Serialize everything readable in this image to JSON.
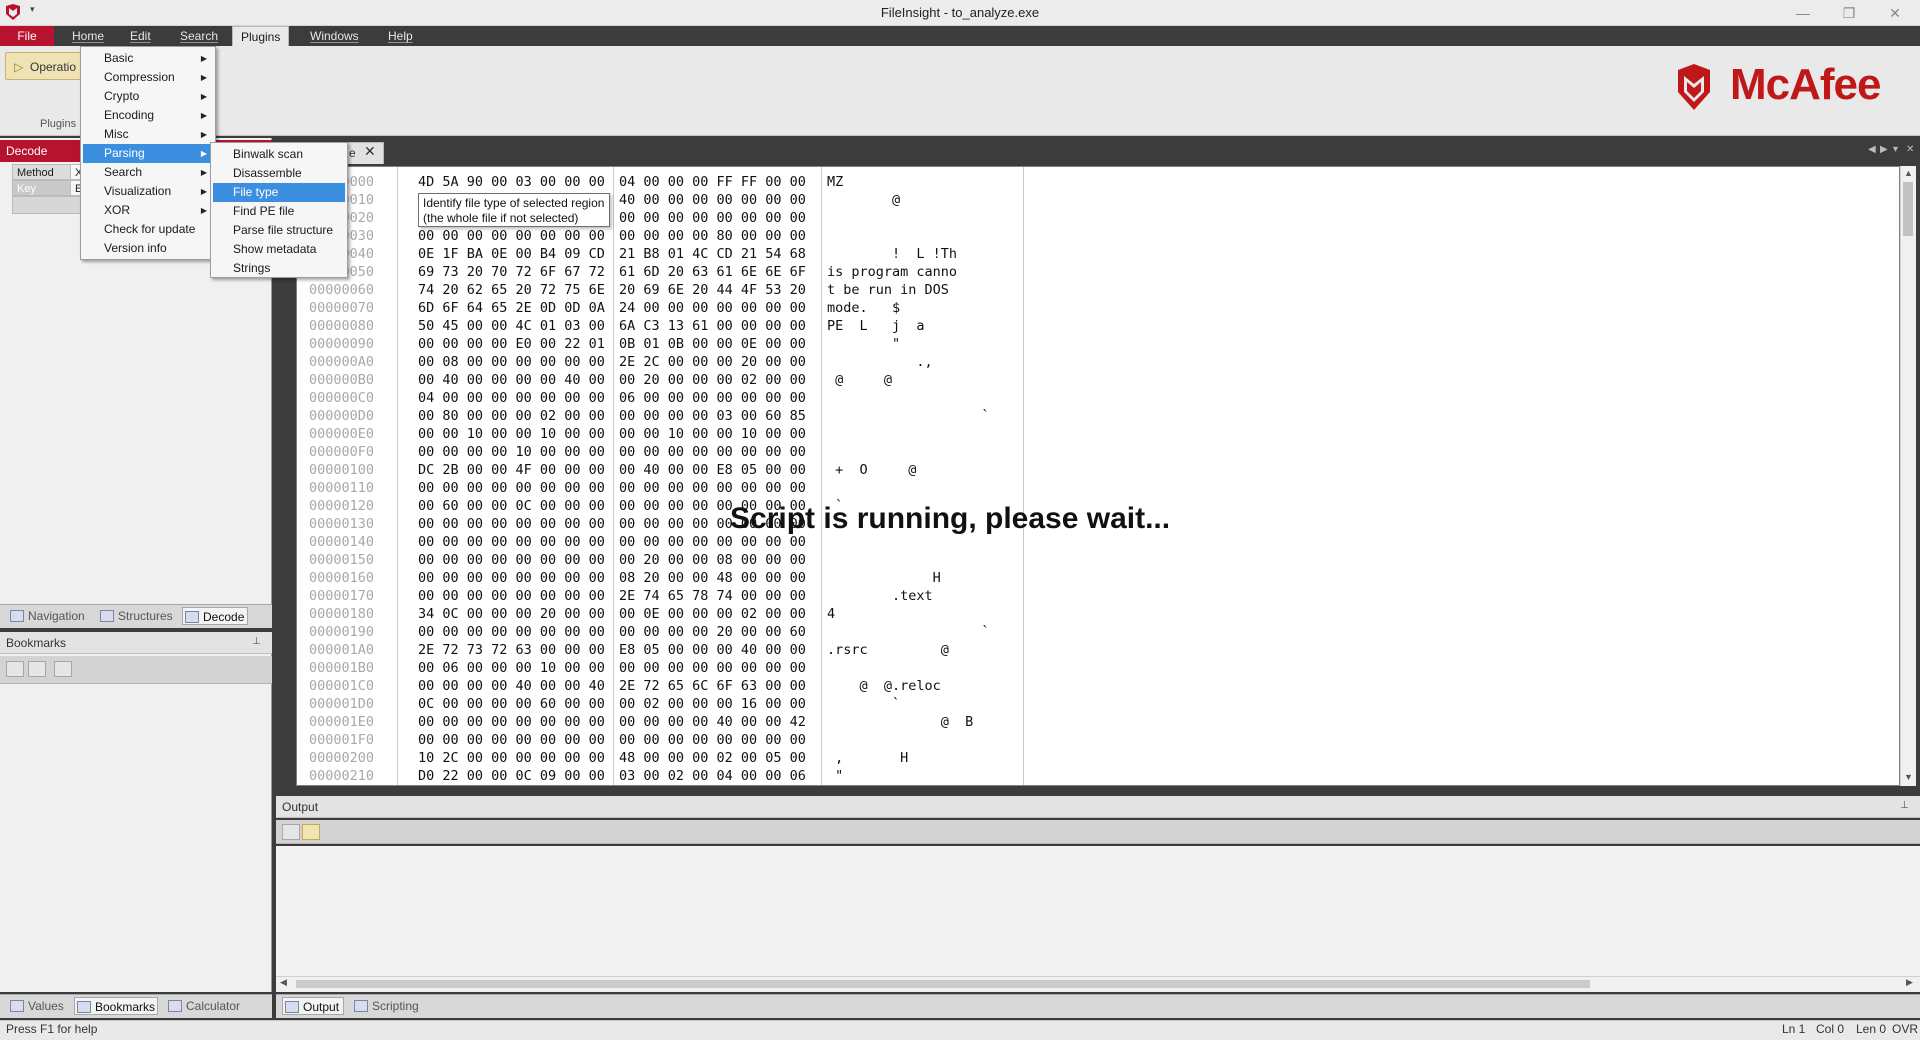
{
  "window": {
    "title": "FileInsight - to_analyze.exe",
    "controls": [
      "—",
      "❐",
      "✕"
    ]
  },
  "menubar": {
    "tabs": [
      "File",
      "Home",
      "Edit",
      "Search",
      "Plugins",
      "Windows",
      "Help"
    ]
  },
  "ribbon": {
    "operations_label": "Operatio",
    "group_label": "Plugins",
    "brand": "McAfee"
  },
  "plugins_menu": {
    "items": [
      {
        "label": "Basic",
        "submenu": true
      },
      {
        "label": "Compression",
        "submenu": true
      },
      {
        "label": "Crypto",
        "submenu": true
      },
      {
        "label": "Encoding",
        "submenu": true
      },
      {
        "label": "Misc",
        "submenu": true
      },
      {
        "label": "Parsing",
        "submenu": true
      },
      {
        "label": "Search",
        "submenu": true
      },
      {
        "label": "Visualization",
        "submenu": true
      },
      {
        "label": "XOR",
        "submenu": true
      },
      {
        "label": "Check for update",
        "submenu": false
      },
      {
        "label": "Version info",
        "submenu": false
      }
    ],
    "highlighted": "Parsing"
  },
  "parsing_submenu": {
    "items": [
      "Binwalk scan",
      "Disassemble",
      "File type",
      "Find PE file",
      "Parse file structure",
      "Show metadata",
      "Strings"
    ],
    "highlighted": "File type"
  },
  "tooltip": {
    "line1": "Identify file type of selected region",
    "line2": "(the whole file if not selected)"
  },
  "decode_panel": {
    "title": "Decode",
    "method_label": "Method",
    "method_value": "X",
    "key_label": "Key",
    "key_value": "E"
  },
  "left_tabs": [
    "Navigation",
    "Structures",
    "Decode"
  ],
  "bookmarks": {
    "title": "Bookmarks",
    "pin": "⊥"
  },
  "left_bottom_tabs": [
    "Values",
    "Bookmarks",
    "Calculator"
  ],
  "document": {
    "tab_label": "e",
    "close": "✕"
  },
  "hex_rows": [
    {
      "off": "00000000",
      "h1": "4D 5A 90 00 03 00 00 00",
      "h2": "04 00 00 00 FF FF 00 00",
      "asc": "MZ"
    },
    {
      "off": "00000010",
      "h1": "B8 00 00 00 00 00 00 00",
      "h2": "40 00 00 00 00 00 00 00",
      "asc": "        @"
    },
    {
      "off": "00000020",
      "h1": "00 00 00 00 00 00 00 00",
      "h2": "00 00 00 00 00 00 00 00",
      "asc": ""
    },
    {
      "off": "00000030",
      "h1": "00 00 00 00 00 00 00 00",
      "h2": "00 00 00 00 80 00 00 00",
      "asc": ""
    },
    {
      "off": "00000040",
      "h1": "0E 1F BA 0E 00 B4 09 CD",
      "h2": "21 B8 01 4C CD 21 54 68",
      "asc": "        !  L !Th"
    },
    {
      "off": "00000050",
      "h1": "69 73 20 70 72 6F 67 72",
      "h2": "61 6D 20 63 61 6E 6E 6F",
      "asc": "is program canno"
    },
    {
      "off": "00000060",
      "h1": "74 20 62 65 20 72 75 6E",
      "h2": "20 69 6E 20 44 4F 53 20",
      "asc": "t be run in DOS"
    },
    {
      "off": "00000070",
      "h1": "6D 6F 64 65 2E 0D 0D 0A",
      "h2": "24 00 00 00 00 00 00 00",
      "asc": "mode.   $"
    },
    {
      "off": "00000080",
      "h1": "50 45 00 00 4C 01 03 00",
      "h2": "6A C3 13 61 00 00 00 00",
      "asc": "PE  L   j  a"
    },
    {
      "off": "00000090",
      "h1": "00 00 00 00 E0 00 22 01",
      "h2": "0B 01 0B 00 00 0E 00 00",
      "asc": "        \""
    },
    {
      "off": "000000A0",
      "h1": "00 08 00 00 00 00 00 00",
      "h2": "2E 2C 00 00 00 20 00 00",
      "asc": "           .,"
    },
    {
      "off": "000000B0",
      "h1": "00 40 00 00 00 00 40 00",
      "h2": "00 20 00 00 00 02 00 00",
      "asc": " @     @"
    },
    {
      "off": "000000C0",
      "h1": "04 00 00 00 00 00 00 00",
      "h2": "06 00 00 00 00 00 00 00",
      "asc": ""
    },
    {
      "off": "000000D0",
      "h1": "00 80 00 00 00 02 00 00",
      "h2": "00 00 00 00 03 00 60 85",
      "asc": "                   `"
    },
    {
      "off": "000000E0",
      "h1": "00 00 10 00 00 10 00 00",
      "h2": "00 00 10 00 00 10 00 00",
      "asc": ""
    },
    {
      "off": "000000F0",
      "h1": "00 00 00 00 10 00 00 00",
      "h2": "00 00 00 00 00 00 00 00",
      "asc": ""
    },
    {
      "off": "00000100",
      "h1": "DC 2B 00 00 4F 00 00 00",
      "h2": "00 40 00 00 E8 05 00 00",
      "asc": " +  O     @"
    },
    {
      "off": "00000110",
      "h1": "00 00 00 00 00 00 00 00",
      "h2": "00 00 00 00 00 00 00 00",
      "asc": ""
    },
    {
      "off": "00000120",
      "h1": "00 60 00 00 0C 00 00 00",
      "h2": "00 00 00 00 00 00 00 00",
      "asc": " `"
    },
    {
      "off": "00000130",
      "h1": "00 00 00 00 00 00 00 00",
      "h2": "00 00 00 00 00 00 00 00",
      "asc": ""
    },
    {
      "off": "00000140",
      "h1": "00 00 00 00 00 00 00 00",
      "h2": "00 00 00 00 00 00 00 00",
      "asc": ""
    },
    {
      "off": "00000150",
      "h1": "00 00 00 00 00 00 00 00",
      "h2": "00 20 00 00 08 00 00 00",
      "asc": ""
    },
    {
      "off": "00000160",
      "h1": "00 00 00 00 00 00 00 00",
      "h2": "08 20 00 00 48 00 00 00",
      "asc": "             H"
    },
    {
      "off": "00000170",
      "h1": "00 00 00 00 00 00 00 00",
      "h2": "2E 74 65 78 74 00 00 00",
      "asc": "        .text"
    },
    {
      "off": "00000180",
      "h1": "34 0C 00 00 00 20 00 00",
      "h2": "00 0E 00 00 00 02 00 00",
      "asc": "4"
    },
    {
      "off": "00000190",
      "h1": "00 00 00 00 00 00 00 00",
      "h2": "00 00 00 00 20 00 00 60",
      "asc": "                   `"
    },
    {
      "off": "000001A0",
      "h1": "2E 72 73 72 63 00 00 00",
      "h2": "E8 05 00 00 00 40 00 00",
      "asc": ".rsrc         @"
    },
    {
      "off": "000001B0",
      "h1": "00 06 00 00 00 10 00 00",
      "h2": "00 00 00 00 00 00 00 00",
      "asc": ""
    },
    {
      "off": "000001C0",
      "h1": "00 00 00 00 40 00 00 40",
      "h2": "2E 72 65 6C 6F 63 00 00",
      "asc": "    @  @.reloc"
    },
    {
      "off": "000001D0",
      "h1": "0C 00 00 00 00 60 00 00",
      "h2": "00 02 00 00 00 16 00 00",
      "asc": "        `"
    },
    {
      "off": "000001E0",
      "h1": "00 00 00 00 00 00 00 00",
      "h2": "00 00 00 00 40 00 00 42",
      "asc": "              @  B"
    },
    {
      "off": "000001F0",
      "h1": "00 00 00 00 00 00 00 00",
      "h2": "00 00 00 00 00 00 00 00",
      "asc": ""
    },
    {
      "off": "00000200",
      "h1": "10 2C 00 00 00 00 00 00",
      "h2": "48 00 00 00 02 00 05 00",
      "asc": " ,       H"
    },
    {
      "off": "00000210",
      "h1": "D0 22 00 00 0C 09 00 00",
      "h2": "03 00 02 00 04 00 00 06",
      "asc": " \""
    },
    {
      "off": "00000220",
      "h1": "00 00 00 00 00 00 00 00",
      "h2": "00 00 00 00 00 00 00 00",
      "asc": ""
    }
  ],
  "running_message": "Script is running, please wait...",
  "output": {
    "title": "Output",
    "pin": "⊥"
  },
  "output_tabs": [
    "Output",
    "Scripting"
  ],
  "status": {
    "help": "Press F1 for help",
    "ln": "Ln 1",
    "col": "Col 0",
    "len": "Len 0",
    "mode": "OVR"
  }
}
